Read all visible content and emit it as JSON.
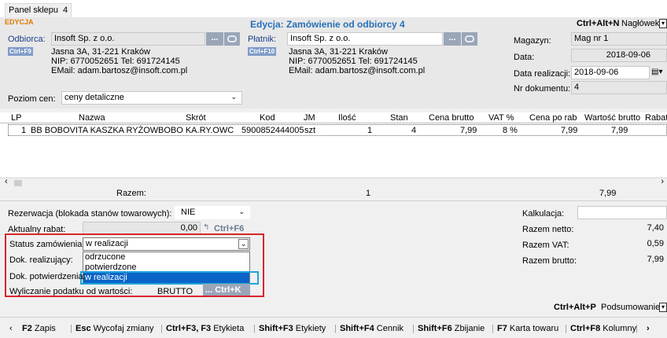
{
  "tab": {
    "label": "Panel sklepu",
    "number": "4"
  },
  "mode_label": "EDYCJA",
  "window_title": "Edycja: Zamówienie od odbiorcy 4",
  "header_shortcut": "Ctrl+Alt+N",
  "header_label": "Nagłówek",
  "odbiorca": {
    "label": "Odbiorca:",
    "shortcut": "Ctrl+F9",
    "value": "Insoft Sp. z o.o.",
    "addr1": "Jasna 3A, 31-221 Kraków",
    "addr2": "NIP: 6770052651 Tel: 691724145",
    "addr3": "EMail: adam.bartosz@insoft.com.pl"
  },
  "platnik": {
    "label": "Płatnik:",
    "shortcut": "Ctrl+F10",
    "value": "Insoft Sp. z o.o.",
    "addr1": "Jasna 3A, 31-221 Kraków",
    "addr2": "NIP: 6770052651 Tel: 691724145",
    "addr3": "EMail: adam.bartosz@insoft.com.pl"
  },
  "dots": "...",
  "magazyn": {
    "label": "Magazyn:",
    "value": "Mag nr 1"
  },
  "data": {
    "label": "Data:",
    "value": "2018-09-06"
  },
  "data_realizacji": {
    "label": "Data realizacji:",
    "value": "2018-09-06"
  },
  "nr_dokumentu": {
    "label": "Nr dokumentu:",
    "value": "4"
  },
  "poziom_cen": {
    "label": "Poziom cen:",
    "value": "ceny detaliczne"
  },
  "table": {
    "headers": [
      "LP",
      "Nazwa",
      "Skrót",
      "Kod",
      "JM",
      "Ilość",
      "Stan",
      "Cena brutto",
      "VAT %",
      "Cena po rab",
      "Wartość brutto",
      "Rabat"
    ],
    "row": [
      "1",
      "BB BOBOVITA KASZKA RYŻOW",
      "BOBO KA.RY.OWC",
      "5900852444005",
      "szt",
      "1",
      "4",
      "7,99",
      "8 %",
      "7,99",
      "7,99",
      ""
    ]
  },
  "razem": {
    "label": "Razem:",
    "qty": "1",
    "total": "7,99"
  },
  "rezerwacja": {
    "label": "Rezerwacja (blokada stanów towarowych):",
    "value": "NIE"
  },
  "rabat": {
    "label": "Aktualny rabat:",
    "value": "0,00",
    "shortcut": "Ctrl+F6"
  },
  "status": {
    "label": "Status zamówienia:",
    "value": "w realizacji",
    "options": [
      "odrzucone",
      "potwierdzone",
      "w realizacji"
    ]
  },
  "dok_realizujacy": {
    "label": "Dok. realizujący:"
  },
  "dok_potwierdzenia": {
    "label": "Dok. potwierdzenia:"
  },
  "podatek": {
    "label": "Wyliczanie podatku od wartości:",
    "value": "BRUTTO",
    "shortcut": "Ctrl+K"
  },
  "kalkulacja": {
    "label": "Kalkulacja:"
  },
  "razem_netto": {
    "label": "Razem netto:",
    "value": "7,40"
  },
  "razem_vat": {
    "label": "Razem VAT:",
    "value": "0,59"
  },
  "razem_brutto": {
    "label": "Razem brutto:",
    "value": "7,99"
  },
  "podsumowanie": {
    "shortcut": "Ctrl+Alt+P",
    "label": "Podsumowanie"
  },
  "fkeys": [
    {
      "key": "F2",
      "label": "Zapis"
    },
    {
      "key": "Esc",
      "label": "Wycofaj zmiany"
    },
    {
      "key": "Ctrl+F3, F3",
      "label": "Etykieta"
    },
    {
      "key": "Shift+F3",
      "label": "Etykiety"
    },
    {
      "key": "Shift+F4",
      "label": "Cennik"
    },
    {
      "key": "Shift+F6",
      "label": "Zbijanie"
    },
    {
      "key": "F7",
      "label": "Karta towaru"
    },
    {
      "key": "Ctrl+F8",
      "label": "Kolumny"
    }
  ],
  "colors": {
    "accent": "#2970b8",
    "mode": "#e07b00",
    "highlight_red": "#d9262b",
    "selection": "#0a64c8",
    "focus_cyan": "#1fa3d9"
  }
}
